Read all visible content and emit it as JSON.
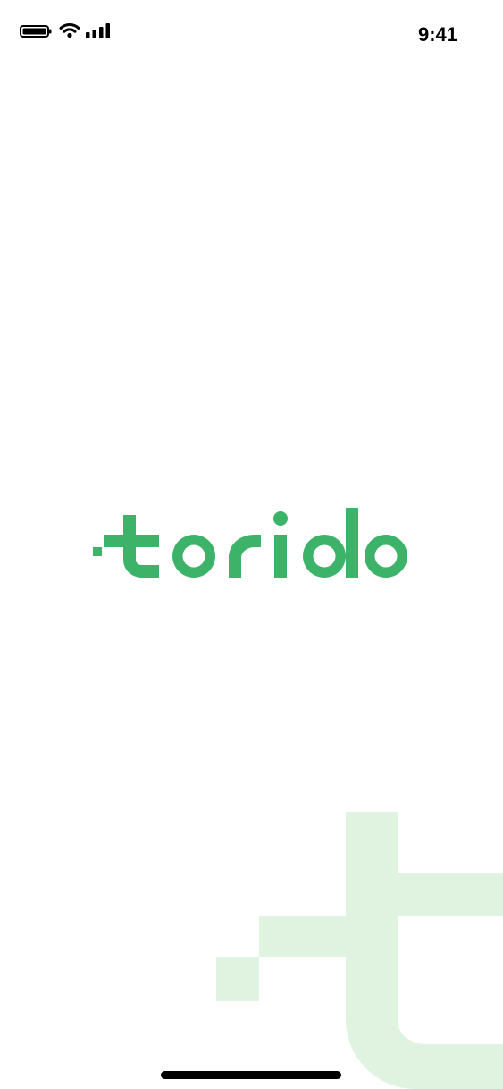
{
  "status_bar": {
    "time": "9:41",
    "icons": [
      "battery-icon",
      "wifi-icon",
      "cellular-signal-icon"
    ]
  },
  "splash": {
    "logo_text": "torido",
    "logo_color": "#3db36a",
    "brand_mark_color": "#e0f3e1"
  },
  "system": {
    "home_indicator_color": "#000000"
  }
}
